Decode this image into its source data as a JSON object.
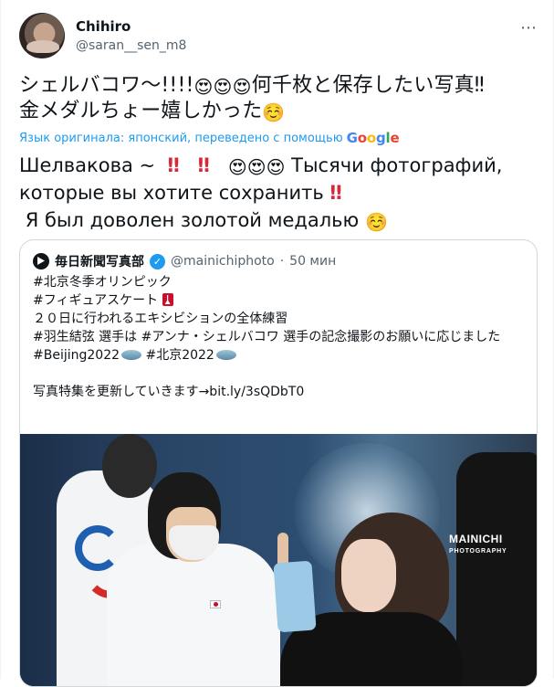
{
  "author": {
    "name": "Chihiro",
    "handle": "@saran__sen_m8"
  },
  "tweet": {
    "original_line1": "シェルバコワ〜!!!!",
    "original_line1_after": "何千枚と保存したい写真‼",
    "original_line2": "金メダルちょー嬉しかった",
    "translated_by": "Язык оригинала: японский, переведено с помощью",
    "google_letters": [
      "G",
      "o",
      "o",
      "g",
      "l",
      "e"
    ],
    "translation_line1_a": "Шелвакова ~",
    "translation_line1_b": "Тысячи фотографий,",
    "translation_line2": "которые вы хотите сохранить",
    "translation_line3": "Я был доволен золотой медалью"
  },
  "quote": {
    "name": "毎日新聞写真部",
    "handle": "@mainichiphoto",
    "separator": "·",
    "time": "50 мин",
    "line1": "#北京冬季オリンピック",
    "line2": "#フィギュアスケート",
    "line3": "２０日に行われるエキシビションの全体練習",
    "line4": "#羽生結弦 選手は #アンナ・シェルバコワ 選手の記念撮影のお願いに応じました",
    "line5_a": "#Beijing2022",
    "line5_b": "#北京2022",
    "line6": "写真特集を更新していきます→bit.ly/3sQDbT0",
    "watermark_top": "MAINICHI",
    "watermark_bottom": "PHOTOGRAPHY"
  },
  "icons": {
    "more": "⋯",
    "heart_eyes": "😍",
    "smile_blush": "☺️",
    "double_bang": "‼",
    "verified_check": "✓"
  },
  "colors": {
    "link": "#1d9bf0",
    "secondary_text": "#536471",
    "border": "#cfd9de",
    "bang_red": "#d8293a"
  }
}
